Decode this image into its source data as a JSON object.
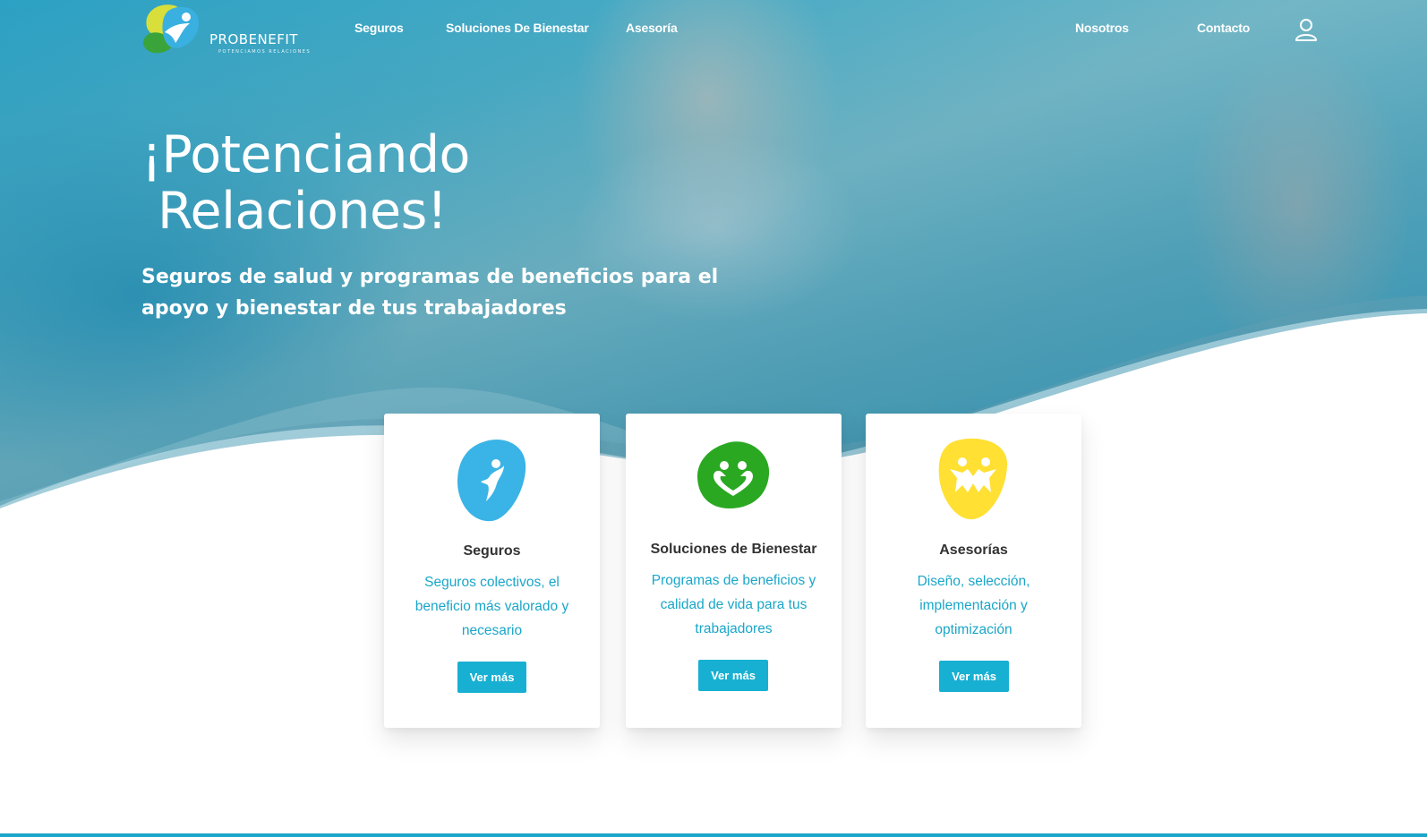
{
  "brand": {
    "name": "PROBENEFIT",
    "tagline": "POTENCIAMOS RELACIONES"
  },
  "nav": {
    "items": [
      {
        "label": "Seguros"
      },
      {
        "label": "Soluciones De Bienestar"
      },
      {
        "label": "Asesoría"
      },
      {
        "label": "Nosotros"
      },
      {
        "label": "Contacto"
      }
    ],
    "account_icon": "user-icon"
  },
  "hero": {
    "title_line1": "¡Potenciando",
    "title_line2": "Relaciones!",
    "subtitle": "Seguros de salud y programas de beneficios para el apoyo y bienestar de tus trabajadores"
  },
  "cards": [
    {
      "icon": "person-jumping-icon",
      "icon_color": "#3ab4e6",
      "title": "Seguros",
      "description": "Seguros colectivos, el beneficio más valorado y necesario",
      "button": "Ver más"
    },
    {
      "icon": "heart-people-icon",
      "icon_color": "#2aa822",
      "title": "Soluciones de Bienestar",
      "description": "Programas de beneficios y calidad de vida para tus trabajadores",
      "button": "Ver más"
    },
    {
      "icon": "team-stars-icon",
      "icon_color": "#ffe033",
      "title": "Asesorías",
      "description": "Diseño, selección, implementación y optimización",
      "button": "Ver más"
    }
  ],
  "colors": {
    "accent": "#18b0d2",
    "text_accent": "#1aa6c8",
    "card_title": "#333333"
  }
}
